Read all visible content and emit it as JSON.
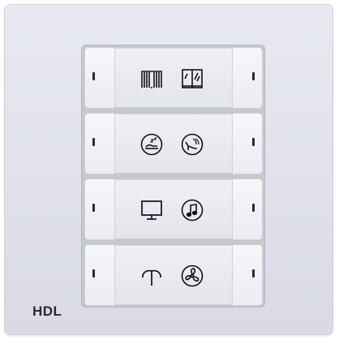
{
  "brand": {
    "label": "HDL"
  },
  "keys": [
    {
      "left_icon": "curtain-icon",
      "right_icon": "window-blind-icon"
    },
    {
      "left_icon": "sleep-scene-icon",
      "right_icon": "relax-scene-icon"
    },
    {
      "left_icon": "tv-monitor-icon",
      "right_icon": "music-note-icon"
    },
    {
      "left_icon": "double-lamp-icon",
      "right_icon": "fan-icon"
    }
  ],
  "colors": {
    "panel": "#e3e4ec",
    "key": "#f0f0f4",
    "icon_stroke": "#111111",
    "led": "#2a2a2e"
  }
}
